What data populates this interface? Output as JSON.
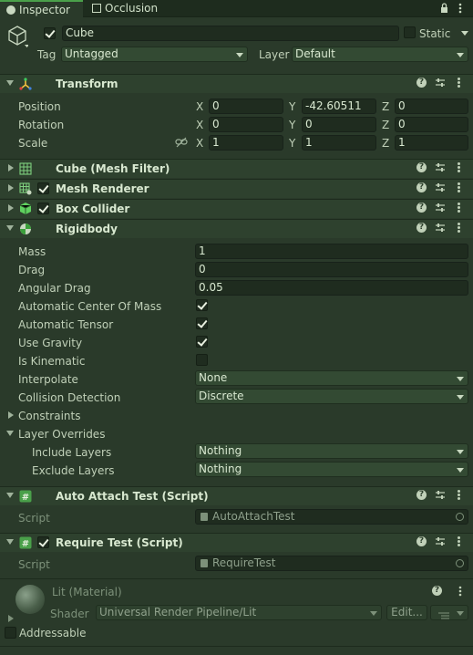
{
  "tabs": [
    {
      "label": "Inspector"
    },
    {
      "label": "Occlusion"
    }
  ],
  "object": {
    "name": "Cube",
    "static_label": "Static",
    "tag_label": "Tag",
    "tag_value": "Untagged",
    "layer_label": "Layer",
    "layer_value": "Default"
  },
  "transform": {
    "title": "Transform",
    "position": {
      "label": "Position",
      "x": "0",
      "y": "-42.60511",
      "z": "0"
    },
    "rotation": {
      "label": "Rotation",
      "x": "0",
      "y": "0",
      "z": "0"
    },
    "scale": {
      "label": "Scale",
      "x": "1",
      "y": "1",
      "z": "1"
    },
    "axis": {
      "x": "X",
      "y": "Y",
      "z": "Z"
    }
  },
  "components": {
    "mesh_filter": "Cube (Mesh Filter)",
    "mesh_renderer": "Mesh Renderer",
    "box_collider": "Box Collider"
  },
  "rigidbody": {
    "title": "Rigidbody",
    "mass": {
      "label": "Mass",
      "value": "1"
    },
    "drag": {
      "label": "Drag",
      "value": "0"
    },
    "angular_drag": {
      "label": "Angular Drag",
      "value": "0.05"
    },
    "auto_com": {
      "label": "Automatic Center Of Mass"
    },
    "auto_tensor": {
      "label": "Automatic Tensor"
    },
    "use_gravity": {
      "label": "Use Gravity"
    },
    "is_kinematic": {
      "label": "Is Kinematic"
    },
    "interpolate": {
      "label": "Interpolate",
      "value": "None"
    },
    "collision": {
      "label": "Collision Detection",
      "value": "Discrete"
    },
    "constraints": {
      "label": "Constraints"
    },
    "layer_overrides": {
      "label": "Layer Overrides"
    },
    "include_layers": {
      "label": "Include Layers",
      "value": "Nothing"
    },
    "exclude_layers": {
      "label": "Exclude Layers",
      "value": "Nothing"
    }
  },
  "scripts": [
    {
      "title": "Auto Attach Test (Script)",
      "label": "Script",
      "value": "AutoAttachTest"
    },
    {
      "title": "Require Test (Script)",
      "label": "Script",
      "value": "RequireTest"
    }
  ],
  "material": {
    "title": "Lit (Material)",
    "shader_label": "Shader",
    "shader_value": "Universal Render Pipeline/Lit",
    "edit_label": "Edit..."
  },
  "addressable": {
    "label": "Addressable"
  },
  "colors": {
    "background": "#2a3a2a",
    "accent": "#4aa04a"
  }
}
